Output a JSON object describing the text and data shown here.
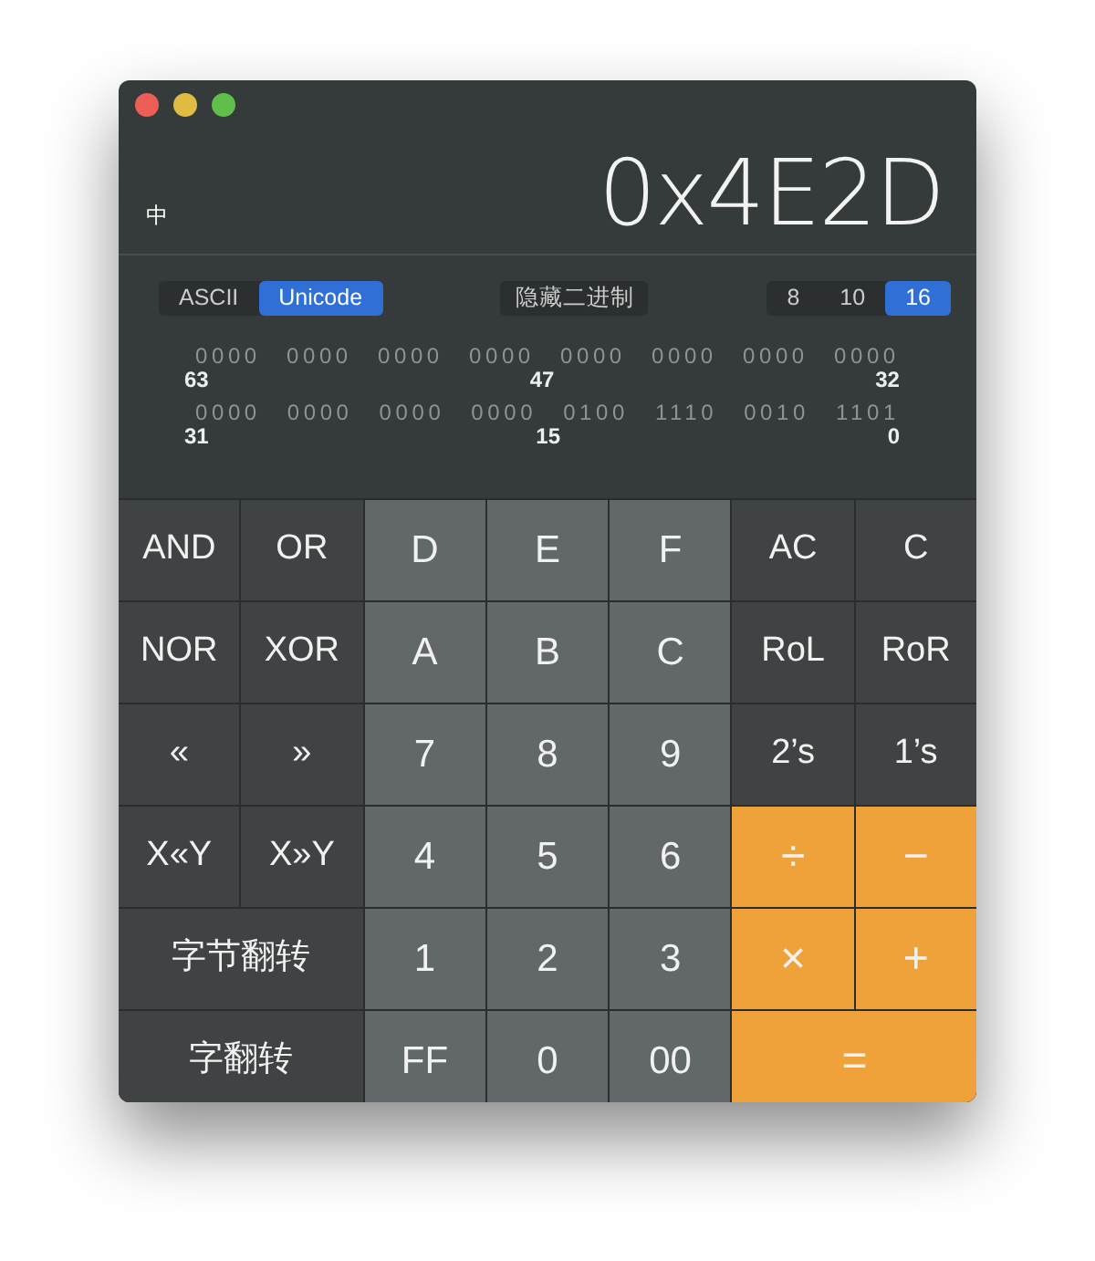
{
  "window": {
    "traffic_lights": [
      {
        "color": "#ec5f57"
      },
      {
        "color": "#e0bc43"
      },
      {
        "color": "#5fbf4a"
      }
    ]
  },
  "display": {
    "character": "中",
    "value": "0x4E2D"
  },
  "encoding": [
    {
      "label": "ASCII",
      "selected": false
    },
    {
      "label": "Unicode",
      "selected": true
    }
  ],
  "binary_toggle": "隐藏二进制",
  "bases": [
    {
      "label": "8",
      "selected": false
    },
    {
      "label": "10",
      "selected": false
    },
    {
      "label": "16",
      "selected": true
    }
  ],
  "bit_rows": [
    {
      "nibbles": [
        "0000",
        "0000",
        "0000",
        "0000",
        "0000",
        "0000",
        "0000",
        "0000"
      ],
      "labels": [
        "63",
        "47",
        "32"
      ]
    },
    {
      "nibbles": [
        "0000",
        "0000",
        "0000",
        "0000",
        "0100",
        "1110",
        "0010",
        "1101"
      ],
      "labels": [
        "31",
        "15",
        "0"
      ]
    }
  ],
  "keys": [
    {
      "label": "AND",
      "kind": "op"
    },
    {
      "label": "OR",
      "kind": "op"
    },
    {
      "label": "D",
      "kind": "digit"
    },
    {
      "label": "E",
      "kind": "digit"
    },
    {
      "label": "F",
      "kind": "digit"
    },
    {
      "label": "AC",
      "kind": "op"
    },
    {
      "label": "C",
      "kind": "op"
    },
    {
      "label": "NOR",
      "kind": "op"
    },
    {
      "label": "XOR",
      "kind": "op"
    },
    {
      "label": "A",
      "kind": "digit"
    },
    {
      "label": "B",
      "kind": "digit"
    },
    {
      "label": "C",
      "kind": "digit"
    },
    {
      "label": "RoL",
      "kind": "op"
    },
    {
      "label": "RoR",
      "kind": "op"
    },
    {
      "label": "«",
      "kind": "op"
    },
    {
      "label": "»",
      "kind": "op"
    },
    {
      "label": "7",
      "kind": "digit"
    },
    {
      "label": "8",
      "kind": "digit"
    },
    {
      "label": "9",
      "kind": "digit"
    },
    {
      "label": "2’s",
      "kind": "op"
    },
    {
      "label": "1’s",
      "kind": "op"
    },
    {
      "label": "X«Y",
      "kind": "op"
    },
    {
      "label": "X»Y",
      "kind": "op"
    },
    {
      "label": "4",
      "kind": "digit"
    },
    {
      "label": "5",
      "kind": "digit"
    },
    {
      "label": "6",
      "kind": "digit"
    },
    {
      "label": "÷",
      "kind": "operator"
    },
    {
      "label": "−",
      "kind": "operator"
    },
    {
      "label": "字节翻转",
      "kind": "wide-op"
    },
    {
      "label": "1",
      "kind": "digit"
    },
    {
      "label": "2",
      "kind": "digit"
    },
    {
      "label": "3",
      "kind": "digit"
    },
    {
      "label": "×",
      "kind": "operator"
    },
    {
      "label": "+",
      "kind": "operator"
    },
    {
      "label": "字翻转",
      "kind": "wide-op"
    },
    {
      "label": "FF",
      "kind": "digit"
    },
    {
      "label": "0",
      "kind": "digit"
    },
    {
      "label": "00",
      "kind": "digit"
    },
    {
      "label": "=",
      "kind": "wide-operator"
    }
  ]
}
